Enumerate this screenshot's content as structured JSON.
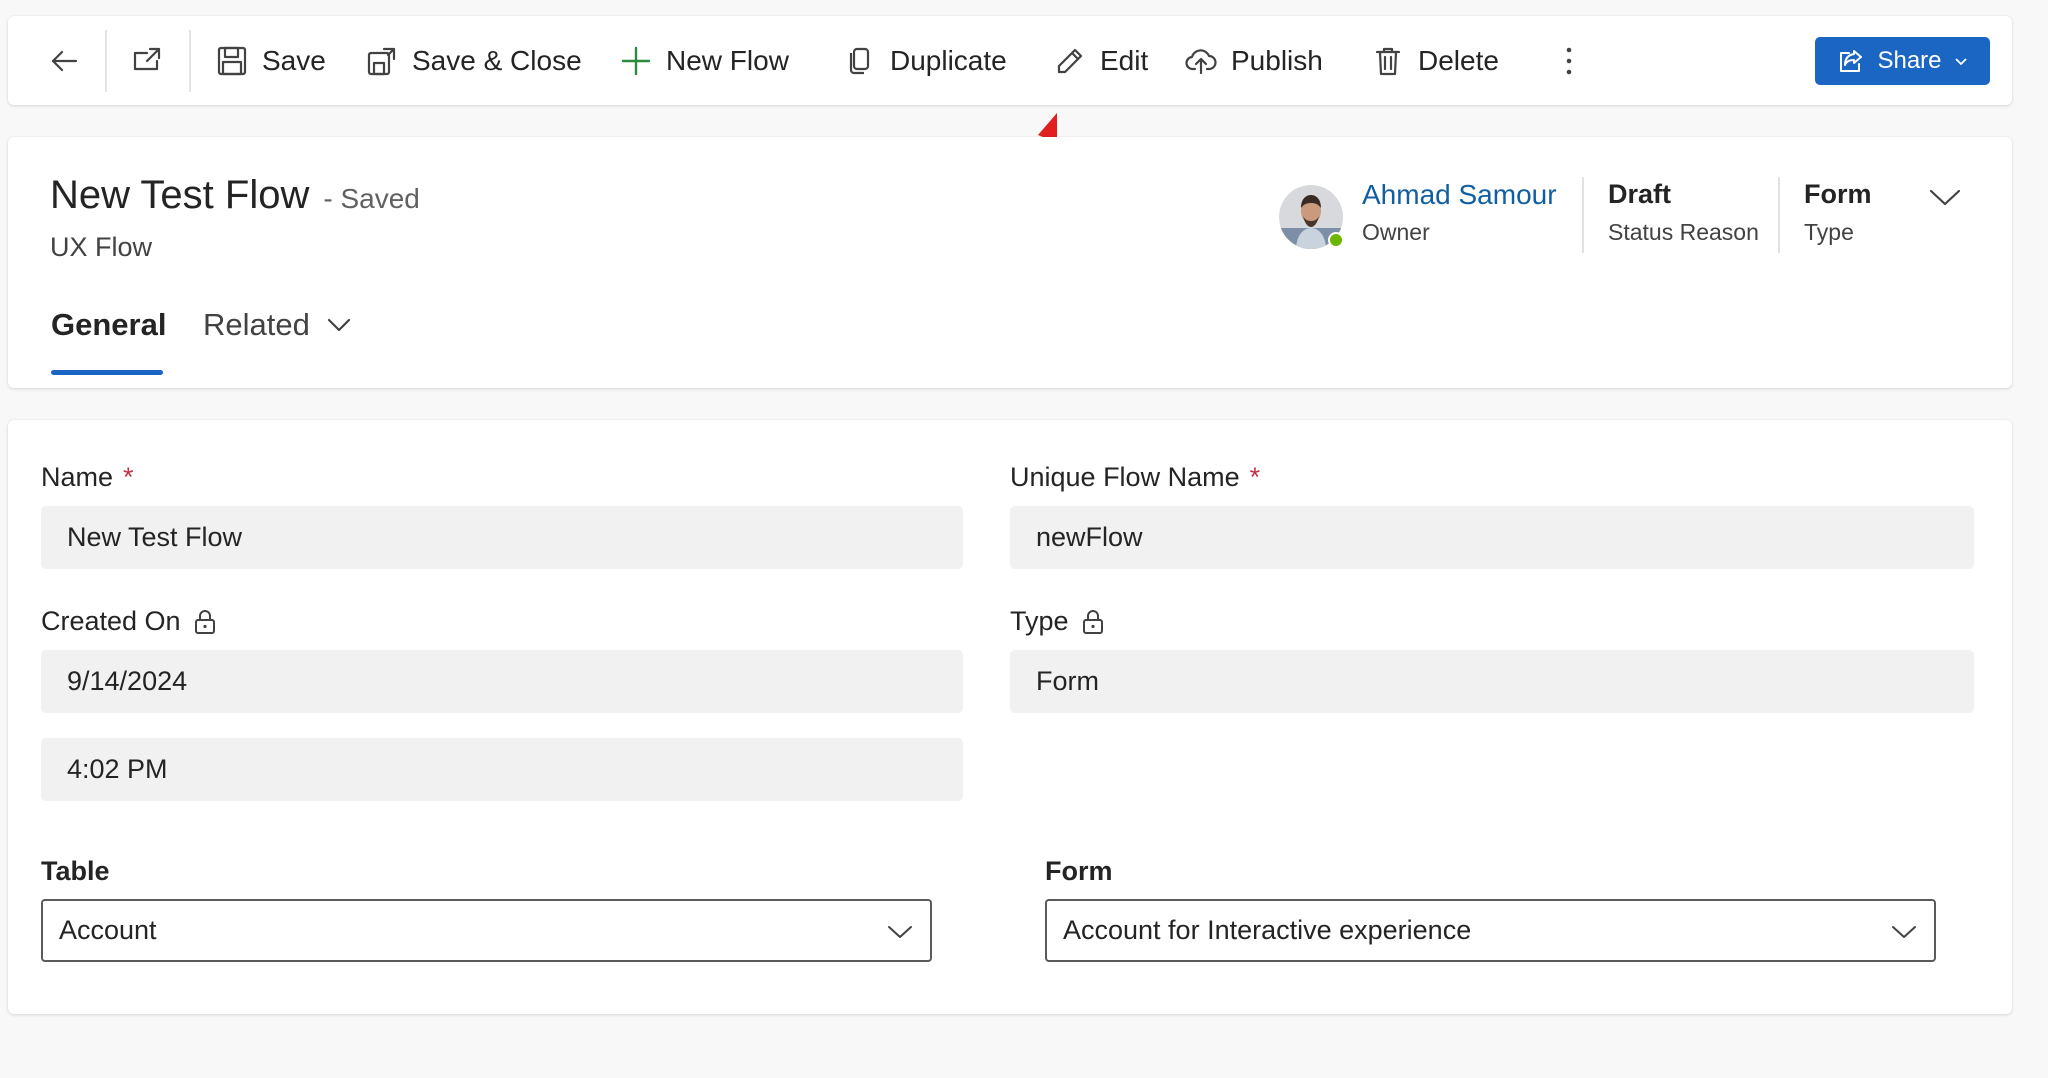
{
  "toolbar": {
    "back_icon": "arrow-left-icon",
    "popout_icon": "open-in-new-window-icon",
    "save_label": "Save",
    "save_close_label": "Save & Close",
    "new_flow_label": "New Flow",
    "duplicate_label": "Duplicate",
    "edit_label": "Edit",
    "publish_label": "Publish",
    "delete_label": "Delete",
    "more_icon": "more-vertical-icon",
    "share_label": "Share"
  },
  "header": {
    "title": "New Test Flow",
    "save_status": "- Saved",
    "entity_type": "UX Flow",
    "owner_name": "Ahmad Samour",
    "owner_label": "Owner",
    "status_value": "Draft",
    "status_label": "Status Reason",
    "type_value": "Form",
    "type_label": "Type",
    "presence_status": "online"
  },
  "tabs": [
    {
      "label": "General",
      "selected": true
    },
    {
      "label": "Related",
      "selected": false
    }
  ],
  "form": {
    "name_label": "Name",
    "name_required": "*",
    "name_value": "New Test Flow",
    "unique_name_label": "Unique Flow Name",
    "unique_name_required": "*",
    "unique_name_value": "newFlow",
    "created_on_label": "Created On",
    "created_on_date": "9/14/2024",
    "created_on_time": "4:02 PM",
    "type_label": "Type",
    "type_value": "Form",
    "table_label": "Table",
    "table_value": "Account",
    "form_label": "Form",
    "form_value": "Account for Interactive experience"
  },
  "colors": {
    "accent": "#1a66c2",
    "owner_link": "#115ea3",
    "required": "#c4314b",
    "annotation_arrow": "#e02020",
    "presence": "#6bb700"
  }
}
